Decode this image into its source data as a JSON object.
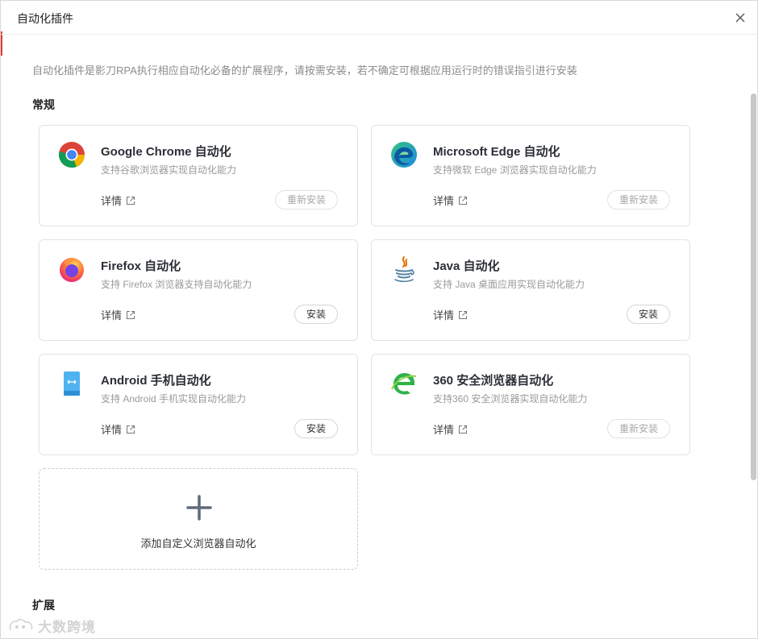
{
  "window": {
    "title": "自动化插件"
  },
  "description": "自动化插件是影刀RPA执行相应自动化必备的扩展程序，请按需安装，若不确定可根据应用运行时的错误指引进行安装",
  "sections": {
    "general": "常规",
    "extension": "扩展"
  },
  "detail_label": "详情",
  "plugins": [
    {
      "name": "Google Chrome 自动化",
      "desc": "支持谷歌浏览器实现自动化能力",
      "button": "重新安装",
      "icon": "chrome-icon"
    },
    {
      "name": "Microsoft Edge 自动化",
      "desc": "支持微软 Edge 浏览器实现自动化能力",
      "button": "重新安装",
      "icon": "edge-icon"
    },
    {
      "name": "Firefox 自动化",
      "desc": "支持 Firefox 浏览器支持自动化能力",
      "button": "安装",
      "icon": "firefox-icon"
    },
    {
      "name": "Java 自动化",
      "desc": "支持 Java 桌面应用实现自动化能力",
      "button": "安装",
      "icon": "java-icon"
    },
    {
      "name": "Android 手机自动化",
      "desc": "支持 Android 手机实现自动化能力",
      "button": "安装",
      "icon": "android-phone-icon"
    },
    {
      "name": "360 安全浏览器自动化",
      "desc": "支持360 安全浏览器实现自动化能力",
      "button": "重新安装",
      "icon": "360-browser-icon"
    }
  ],
  "add_custom": {
    "label": "添加自定义浏览器自动化"
  },
  "watermark": {
    "text": "大数跨境"
  },
  "colors": {
    "accent": "#e53935",
    "border": "#e3e3e3",
    "muted": "#9a9a9a"
  }
}
